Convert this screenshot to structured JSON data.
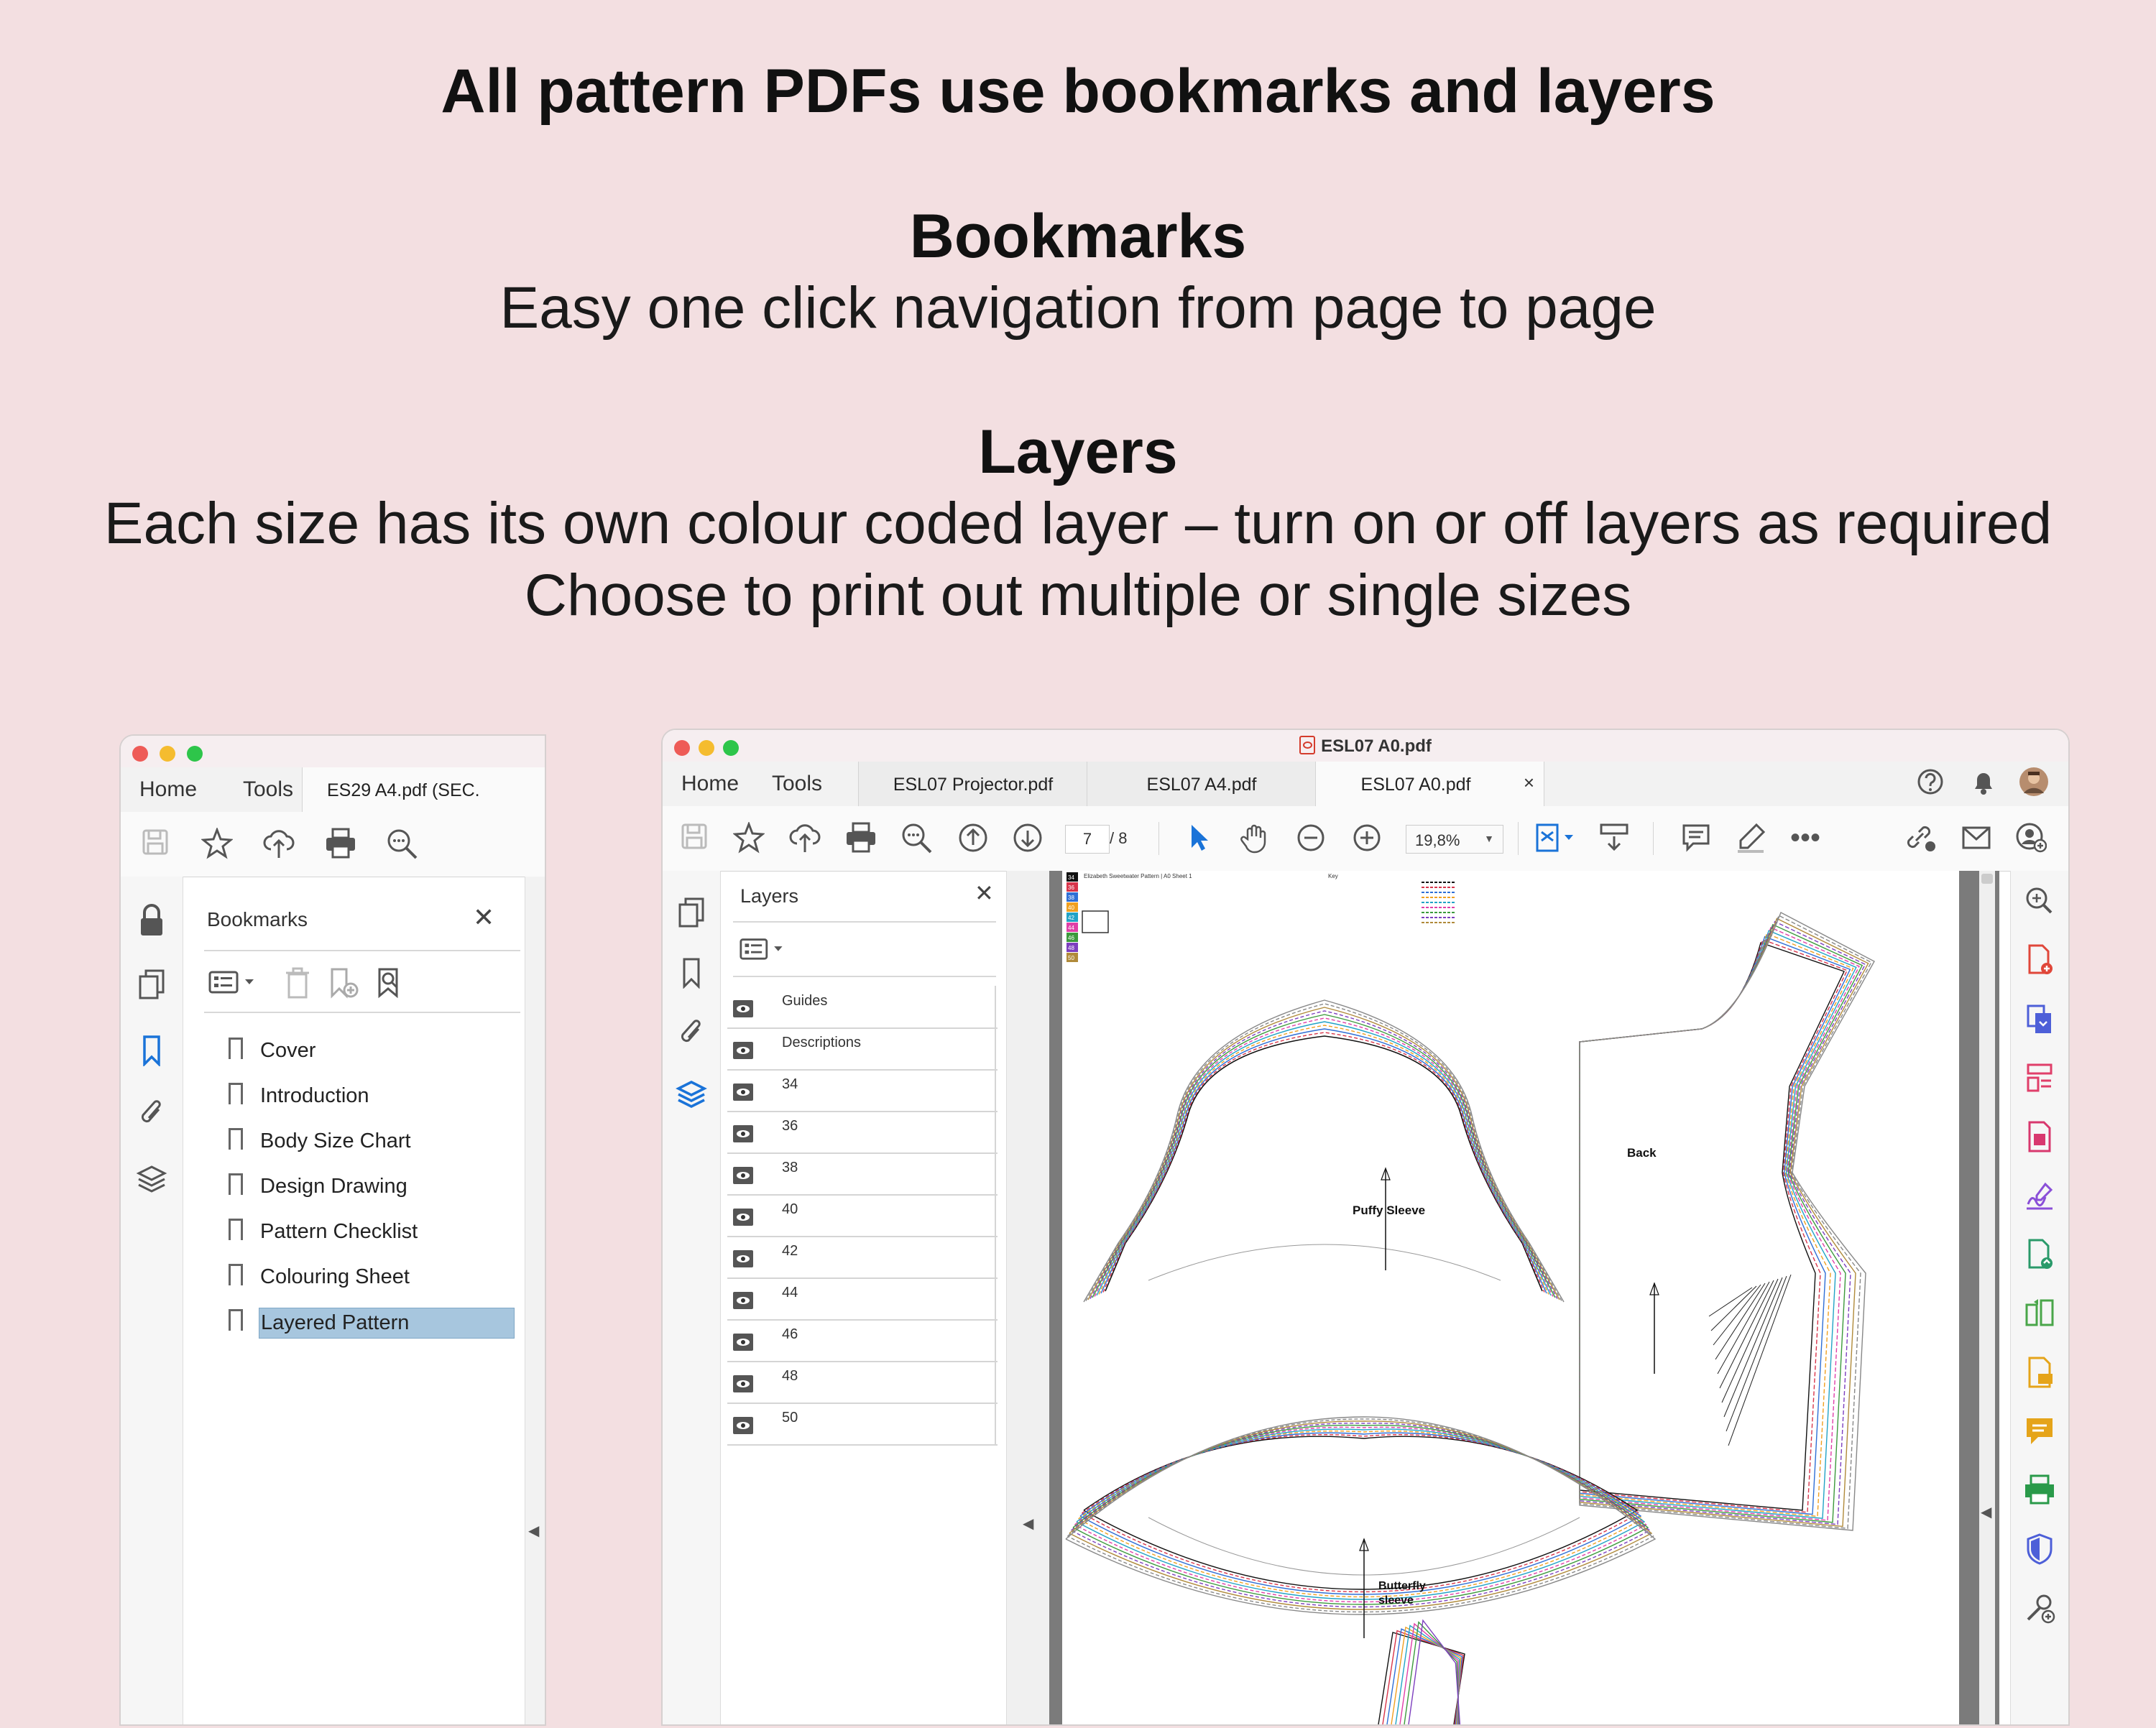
{
  "heading": {
    "main": "All pattern PDFs use bookmarks and layers",
    "bookmarks_title": "Bookmarks",
    "bookmarks_desc": "Easy one click navigation from page to page",
    "layers_title": "Layers",
    "layers_desc_1": "Each size has its own colour coded layer – turn on or off layers as required",
    "layers_desc_2": "Choose to print out multiple or single sizes"
  },
  "left_window": {
    "nav": {
      "home": "Home",
      "tools": "Tools"
    },
    "tab_title": "ES29 A4.pdf (SEC.",
    "panel_title": "Bookmarks",
    "bookmarks": [
      "Cover",
      "Introduction",
      "Body Size Chart",
      "Design Drawing",
      "Pattern Checklist",
      "Colouring Sheet",
      "Layered Pattern"
    ],
    "selected_bookmark": "Layered Pattern"
  },
  "right_window": {
    "title": "ESL07 A0.pdf",
    "nav": {
      "home": "Home",
      "tools": "Tools"
    },
    "tabs": [
      {
        "label": "ESL07 Projector.pdf"
      },
      {
        "label": "ESL07 A4.pdf"
      },
      {
        "label": "ESL07 A0.pdf"
      }
    ],
    "tab_close": "×",
    "page_current": "7",
    "page_total": "/ 8",
    "zoom": "19,8%",
    "panel_title": "Layers",
    "layers": [
      "Guides",
      "Descriptions",
      "34",
      "36",
      "38",
      "40",
      "42",
      "44",
      "46",
      "48",
      "50"
    ]
  },
  "pattern_sheet": {
    "labels": {
      "puffy_sleeve": "Puffy Sleeve",
      "back": "Back",
      "butterfly_1": "Butterfly",
      "butterfly_2": "sleeve",
      "header": "Elizabeth Sweetwater Pattern | A0 Sheet 1",
      "key": "Key"
    },
    "size_legend": [
      {
        "size": "34",
        "color": "#111111"
      },
      {
        "size": "36",
        "color": "#d8344a"
      },
      {
        "size": "38",
        "color": "#2f6fd6"
      },
      {
        "size": "40",
        "color": "#f0a020"
      },
      {
        "size": "42",
        "color": "#22a3c6"
      },
      {
        "size": "44",
        "color": "#e03fa8"
      },
      {
        "size": "46",
        "color": "#3c9a3c"
      },
      {
        "size": "48",
        "color": "#7d3fbf"
      },
      {
        "size": "50",
        "color": "#b08a3a"
      }
    ]
  },
  "colors": {
    "background": "#f3dfe1",
    "selection": "#a7c6de",
    "accent_blue": "#1a73d8"
  }
}
